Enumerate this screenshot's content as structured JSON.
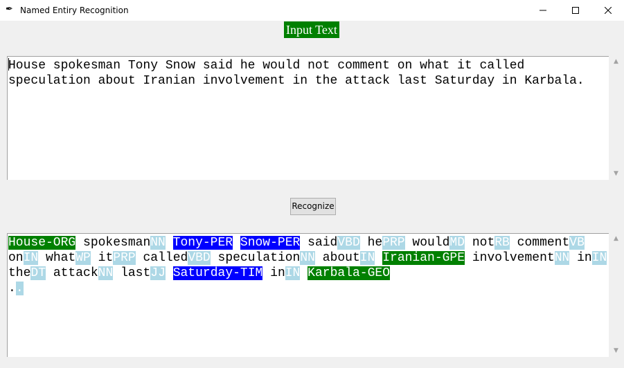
{
  "window": {
    "title": "Named Entiry Recognition",
    "icon": "feather-icon",
    "controls": [
      "minimize-icon",
      "maximize-icon",
      "close-icon"
    ]
  },
  "colors": {
    "entity_org_gpe_geo": "#008000",
    "entity_per_tim": "#0000ff",
    "pos_tag": "#add8e6",
    "label_bg": "#008000"
  },
  "input_label": "Input Text",
  "input_text": "House spokesman Tony Snow said he would not comment on what it called speculation about Iranian involvement in the attack last Saturday in Karbala.",
  "button": {
    "label": "Recognize"
  },
  "output": {
    "tokens": [
      {
        "word": "House-ORG",
        "tag": "",
        "type": "green"
      },
      {
        "word": "spokesman",
        "tag": "NN",
        "type": "pos"
      },
      {
        "word": "Tony-PER",
        "tag": "",
        "type": "blue"
      },
      {
        "word": "Snow-PER",
        "tag": "",
        "type": "blue"
      },
      {
        "word": "said",
        "tag": "VBD",
        "type": "pos"
      },
      {
        "word": "he",
        "tag": "PRP",
        "type": "pos"
      },
      {
        "word": "would",
        "tag": "MD",
        "type": "pos"
      },
      {
        "word": "not",
        "tag": "RB",
        "type": "pos"
      },
      {
        "word": "comment",
        "tag": "VB",
        "type": "pos"
      },
      {
        "word": "on",
        "tag": "IN",
        "type": "pos"
      },
      {
        "word": "what",
        "tag": "WP",
        "type": "pos"
      },
      {
        "word": "it",
        "tag": "PRP",
        "type": "pos"
      },
      {
        "word": "called",
        "tag": "VBD",
        "type": "pos"
      },
      {
        "word": "speculation",
        "tag": "NN",
        "type": "pos"
      },
      {
        "word": "about",
        "tag": "IN",
        "type": "pos"
      },
      {
        "word": "Iranian-GPE",
        "tag": "",
        "type": "green"
      },
      {
        "word": "involvement",
        "tag": "NN",
        "type": "pos"
      },
      {
        "word": "in",
        "tag": "IN",
        "type": "pos"
      },
      {
        "word": "the",
        "tag": "DT",
        "type": "pos"
      },
      {
        "word": "attack",
        "tag": "NN",
        "type": "pos"
      },
      {
        "word": "last",
        "tag": "JJ",
        "type": "pos"
      },
      {
        "word": "Saturday-TIM",
        "tag": "",
        "type": "blue"
      },
      {
        "word": "in",
        "tag": "IN",
        "type": "pos"
      },
      {
        "word": "Karbala-GEO",
        "tag": "",
        "type": "green"
      },
      {
        "word": ".",
        "tag": ".",
        "type": "pos"
      }
    ]
  }
}
